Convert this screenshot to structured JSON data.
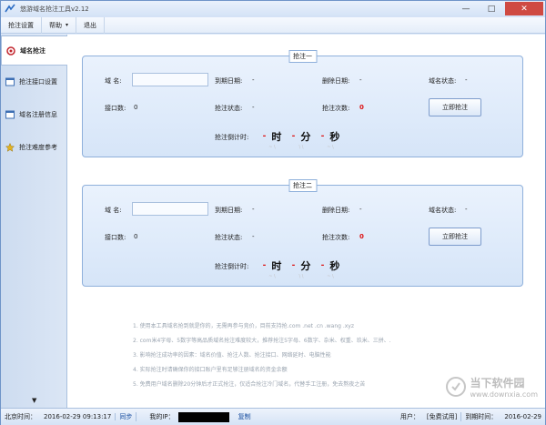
{
  "window": {
    "title": "悠游域名抢注工具v2.12",
    "minimize": "—",
    "maximize": "□",
    "close": "✕"
  },
  "menu": [
    {
      "label": "抢注设置",
      "chevron": false
    },
    {
      "label": "帮助",
      "chevron": true
    },
    {
      "label": "退出",
      "chevron": false
    }
  ],
  "sidebar": {
    "items": [
      {
        "label": "域名抢注",
        "icon": "target-icon"
      },
      {
        "label": "抢注接口设置",
        "icon": "window-icon"
      },
      {
        "label": "域名注册信息",
        "icon": "window-icon"
      },
      {
        "label": "抢注难度参考",
        "icon": "star-icon"
      }
    ],
    "scroll_down": "▼"
  },
  "groups": [
    {
      "title": "抢注一",
      "domain_label": "域  名:",
      "domain_value": "",
      "expire_label": "到期日期:",
      "expire_value": "-",
      "delete_label": "删除日期:",
      "delete_value": "-",
      "status_label": "域名状态:",
      "status_value": "-",
      "port_label": "接口数:",
      "port_value": "0",
      "snipe_status_label": "抢注状态:",
      "snipe_status_value": "-",
      "times_label": "抢注次数:",
      "times_value": "0",
      "button": "立即抢注",
      "countdown_label": "抢注倒计时:",
      "hour": "时",
      "minute": "分",
      "second": "秒",
      "dash": "-",
      "hour_sub": "~ \\",
      "minute_sub": "\\ \\",
      "second_sub": "~ \\"
    },
    {
      "title": "抢注二",
      "domain_label": "域  名:",
      "domain_value": "",
      "expire_label": "到期日期:",
      "expire_value": "-",
      "delete_label": "删除日期:",
      "delete_value": "-",
      "status_label": "域名状态:",
      "status_value": "-",
      "port_label": "接口数:",
      "port_value": "0",
      "snipe_status_label": "抢注状态:",
      "snipe_status_value": "-",
      "times_label": "抢注次数:",
      "times_value": "0",
      "button": "立即抢注",
      "countdown_label": "抢注倒计时:",
      "hour": "时",
      "minute": "分",
      "second": "秒",
      "dash": "-",
      "hour_sub": "~ \\",
      "minute_sub": "\\ \\",
      "second_sub": "~ \\"
    }
  ],
  "notes": [
    "1.  使用本工具域名抢到就是你的，无需再参与竞价，目前支持抢.com .net .cn .wang .xyz",
    "2.  com米4字母、5数字等高品质域名抢注难度较大，推荐抢注5字母、6数字、杂米、权重、玖米、三拼、.",
    "3.  影响抢注成功率的因素：域名价值、抢注人数、抢注接口、网络延时、电脑性能",
    "4.  实际抢注时请确保你的接口账户里有足够注册域名的资金余额",
    "5.  免费用户域名删除20分钟后才正式抢注，仅适合抢注冷门域名，代替手工注册，免去熬夜之苦"
  ],
  "status": {
    "beijing_time_label": "北京时间：",
    "beijing_time": "2016-02-29 09:13:17",
    "sync": "同步",
    "my_ip_label": "我的IP：",
    "copy": "复制",
    "user_label": "用户：",
    "user_value": "[免费试用]",
    "expire_label": "到期时间：",
    "expire_value": "2016-02-29"
  },
  "watermark": {
    "main": "当下软件园",
    "sub": "www.downxia.com"
  },
  "colors": {
    "accent_red": "#dd1111",
    "panel_border": "#8fb0db",
    "frame": "#6f94c8"
  }
}
